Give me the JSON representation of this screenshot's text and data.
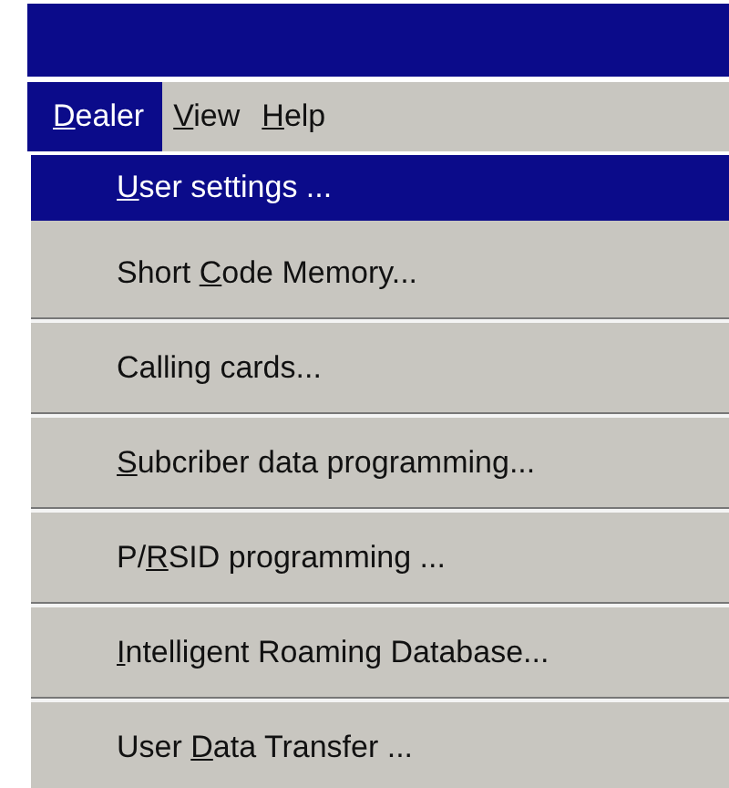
{
  "menubar": [
    {
      "key": "D",
      "after": "ealer",
      "selected": true
    },
    {
      "key": "V",
      "after": "iew",
      "selected": false
    },
    {
      "key": "H",
      "after": "elp",
      "selected": false
    }
  ],
  "menu_items": [
    {
      "key": "U",
      "after": "ser settings ...",
      "selected": true
    },
    {
      "before": "Short ",
      "key": "C",
      "after": "ode Memory...",
      "selected": false
    },
    {
      "before": "Calling cards...",
      "selected": false
    },
    {
      "key": "S",
      "after": "ubcriber data programming...",
      "selected": false
    },
    {
      "before": "P/",
      "key": "R",
      "after": "SID programming ...",
      "selected": false
    },
    {
      "key": "I",
      "after": "ntelligent Roaming Database...",
      "selected": false
    },
    {
      "before": "User ",
      "key": "D",
      "after": "ata Transfer ...",
      "selected": false
    }
  ]
}
